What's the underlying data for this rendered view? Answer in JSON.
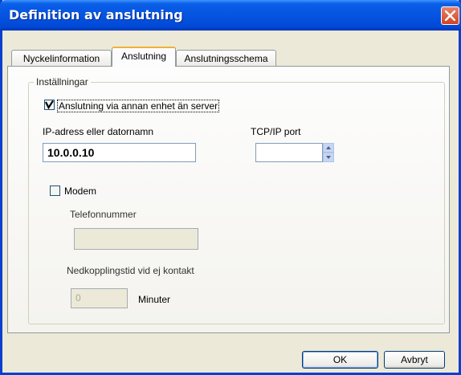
{
  "window": {
    "title": "Definition av anslutning"
  },
  "tabs": [
    {
      "label": "Nyckelinformation"
    },
    {
      "label": "Anslutning"
    },
    {
      "label": "Anslutningsschema"
    }
  ],
  "group": {
    "label": "Inställningar"
  },
  "server_checkbox": {
    "label": "Anslutning via annan enhet än server",
    "checked": true
  },
  "ip": {
    "label": "IP-adress eller datornamn",
    "value": "10.0.0.10"
  },
  "tcp": {
    "label": "TCP/IP port",
    "value": ""
  },
  "modem": {
    "label": "Modem",
    "checked": false
  },
  "phone": {
    "label": "Telefonnummer",
    "value": ""
  },
  "hangup": {
    "label": "Nedkopplingstid vid ej kontakt",
    "value": "0",
    "unit": "Minuter"
  },
  "buttons": {
    "ok": "OK",
    "cancel": "Avbryt"
  },
  "colors": {
    "titlebar": "#0654e0",
    "active_tab_accent": "#f0b038",
    "window_bg": "#ece9d8"
  }
}
